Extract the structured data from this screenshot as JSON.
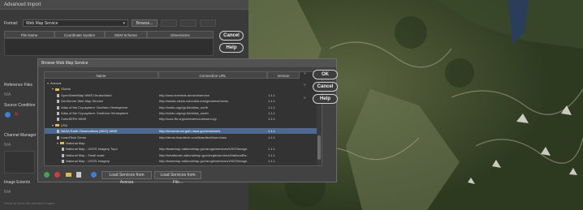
{
  "advanced_import": {
    "title": "Advanced Import",
    "format_label": "Format:",
    "format_value": "Web Map Service",
    "browse_label": "Browse...",
    "columns": [
      "File Name",
      "Coordinate System",
      "DEM Scheme",
      "Dimensions"
    ],
    "cancel_label": "Cancel",
    "help_label": "Help",
    "side_labels": [
      "Reference Files",
      "N/A",
      "Source Condition",
      "Channel Manager",
      "N/A",
      "Image Extents",
      "N/A"
    ],
    "hint": "Show all fields the selected images"
  },
  "browse_dialog": {
    "title": "Browse Web Map Service",
    "columns": {
      "name": "Name",
      "url": "Connection URL",
      "version": "Version"
    },
    "ok_label": "OK",
    "cancel_label": "Cancel",
    "help_label": "Help",
    "load_avenza_label": "Load Services from Avenza",
    "load_file_label": "Load Services from File...",
    "rows": [
      {
        "name": "Avenza",
        "url": "",
        "version": "",
        "kind": "root",
        "indent": 0
      },
      {
        "name": "Global",
        "url": "",
        "version": "",
        "kind": "folder",
        "indent": 1
      },
      {
        "name": "OpenStreetMap WMS Deutschland",
        "url": "http://ows.terrestris.de/osm/service",
        "version": "1.1.1",
        "kind": "leaf",
        "indent": 2
      },
      {
        "name": "GeoServer Web Map Service",
        "url": "http://sedac.ciesin.columbia.edu/geoserver/wms",
        "version": "1.1.1",
        "kind": "leaf",
        "indent": 2
      },
      {
        "name": "Atlas of the Cryosphere: Northern Hemisphere",
        "url": "http://nsidc.org/cgi-bin/atlas_north",
        "version": "1.1.1",
        "kind": "leaf",
        "indent": 2
      },
      {
        "name": "Atlas of the Cryosphere: Southern Hemisphere",
        "url": "http://nsidc.org/cgi-bin/atlas_south",
        "version": "1.1.1",
        "kind": "leaf",
        "indent": 2
      },
      {
        "name": "CubeSERV WMS",
        "url": "http://ccrs-ffe.org/cubeserv/cubeserv.cgi",
        "version": "1.1.1",
        "kind": "leaf",
        "indent": 2
      },
      {
        "name": "USA",
        "url": "",
        "version": "",
        "kind": "folder",
        "indent": 1
      },
      {
        "name": "NASA Earth Observations (NEO) WMS",
        "url": "http://neowms.sci.gsfc.nasa.gov/wms/wms",
        "version": "1.1.1",
        "kind": "leaf",
        "indent": 2,
        "selected": true
      },
      {
        "name": "LizardTech Demo",
        "url": "http://demo.lizardtech.com/lizardtech/iserv/ows",
        "version": "1.1.1",
        "kind": "leaf",
        "indent": 2
      },
      {
        "name": "National Map",
        "url": "",
        "version": "",
        "kind": "folder",
        "indent": 2
      },
      {
        "name": "National Map - USGS Imagery Topo",
        "url": "http://basemap.nationalmap.gov/arcgis/services/USGSImage...",
        "version": "1.1.1",
        "kind": "leaf",
        "indent": 3
      },
      {
        "name": "National Map - Small scale",
        "url": "http://smallscale.nationalmap.gov/arcgis/services/NationalEa...",
        "version": "1.1.1",
        "kind": "leaf",
        "indent": 3
      },
      {
        "name": "National Map - USGS Imagery",
        "url": "http://basemap.nationalmap.gov/arcgis/services/USGSImage...",
        "version": "1.1.1",
        "kind": "leaf",
        "indent": 3
      }
    ]
  },
  "colors": {
    "selection": "#4d6a8e",
    "add": "#3fa34d",
    "remove": "#d23b3b",
    "info": "#3e7fd6",
    "folder": "#e2b84a"
  }
}
